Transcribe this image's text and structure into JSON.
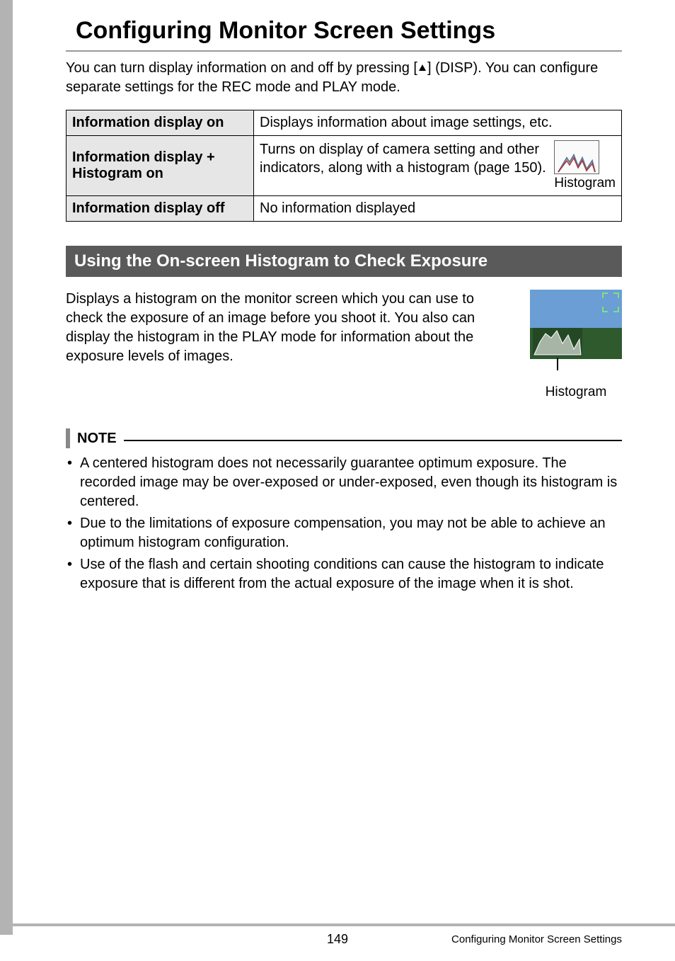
{
  "title": "Configuring Monitor Screen Settings",
  "intro_pre": "You can turn display information on and off by pressing [",
  "intro_post": "] (DISP). You can configure separate settings for the REC mode and PLAY mode.",
  "table": {
    "rows": [
      {
        "label": "Information display on",
        "desc": "Displays information about image settings, etc."
      },
      {
        "label": "Information display + Histogram on",
        "desc": "Turns on display of camera setting and other indicators, along with a histogram (page 150).",
        "thumb_label": "Histogram"
      },
      {
        "label": "Information display off",
        "desc": "No information displayed"
      }
    ]
  },
  "subheading": "Using the On-screen Histogram to Check Exposure",
  "sub_body": "Displays a histogram on the monitor screen which you can use to check the exposure of an image before you shoot it. You also can display the histogram in the PLAY mode for information about the exposure levels of images.",
  "preview_label": "Histogram",
  "note_label": "NOTE",
  "notes": [
    "A centered histogram does not necessarily guarantee optimum exposure. The recorded image may be over-exposed or under-exposed, even though its histogram is centered.",
    "Due to the limitations of exposure compensation, you may not be able to achieve an optimum histogram configuration.",
    "Use of the flash and certain shooting conditions can cause the histogram to indicate exposure that is different from the actual exposure of the image when it is shot."
  ],
  "footer": {
    "page_number": "149",
    "section": "Configuring Monitor Screen Settings"
  }
}
